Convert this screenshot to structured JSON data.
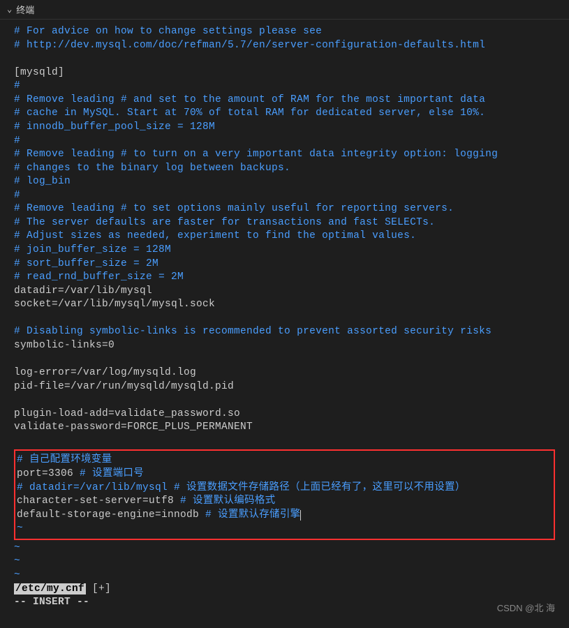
{
  "panel": {
    "title": "终端"
  },
  "terminal": {
    "lines": [
      {
        "type": "comment",
        "text": "# For advice on how to change settings please see"
      },
      {
        "type": "comment",
        "text": "# http://dev.mysql.com/doc/refman/5.7/en/server-configuration-defaults.html"
      },
      {
        "type": "blank",
        "text": ""
      },
      {
        "type": "normal",
        "text": "[mysqld]"
      },
      {
        "type": "comment",
        "text": "#"
      },
      {
        "type": "comment",
        "text": "# Remove leading # and set to the amount of RAM for the most important data"
      },
      {
        "type": "comment",
        "text": "# cache in MySQL. Start at 70% of total RAM for dedicated server, else 10%."
      },
      {
        "type": "comment",
        "text": "# innodb_buffer_pool_size = 128M"
      },
      {
        "type": "comment",
        "text": "#"
      },
      {
        "type": "comment",
        "text": "# Remove leading # to turn on a very important data integrity option: logging"
      },
      {
        "type": "comment",
        "text": "# changes to the binary log between backups."
      },
      {
        "type": "comment",
        "text": "# log_bin"
      },
      {
        "type": "comment",
        "text": "#"
      },
      {
        "type": "comment",
        "text": "# Remove leading # to set options mainly useful for reporting servers."
      },
      {
        "type": "comment",
        "text": "# The server defaults are faster for transactions and fast SELECTs."
      },
      {
        "type": "comment",
        "text": "# Adjust sizes as needed, experiment to find the optimal values."
      },
      {
        "type": "comment",
        "text": "# join_buffer_size = 128M"
      },
      {
        "type": "comment",
        "text": "# sort_buffer_size = 2M"
      },
      {
        "type": "comment",
        "text": "# read_rnd_buffer_size = 2M"
      },
      {
        "type": "normal",
        "text": "datadir=/var/lib/mysql"
      },
      {
        "type": "normal",
        "text": "socket=/var/lib/mysql/mysql.sock"
      },
      {
        "type": "blank",
        "text": ""
      },
      {
        "type": "comment",
        "text": "# Disabling symbolic-links is recommended to prevent assorted security risks"
      },
      {
        "type": "normal",
        "text": "symbolic-links=0"
      },
      {
        "type": "blank",
        "text": ""
      },
      {
        "type": "normal",
        "text": "log-error=/var/log/mysqld.log"
      },
      {
        "type": "normal",
        "text": "pid-file=/var/run/mysqld/mysqld.pid"
      },
      {
        "type": "blank",
        "text": ""
      },
      {
        "type": "normal",
        "text": "plugin-load-add=validate_password.so"
      },
      {
        "type": "normal",
        "text": "validate-password=FORCE_PLUS_PERMANENT"
      },
      {
        "type": "blank",
        "text": ""
      }
    ],
    "boxed_lines": [
      {
        "parts": [
          {
            "cls": "comment",
            "text": "# 自己配置环境变量"
          }
        ]
      },
      {
        "parts": [
          {
            "cls": "normal",
            "text": "port=3306 "
          },
          {
            "cls": "comment",
            "text": "# 设置端口号"
          }
        ]
      },
      {
        "parts": [
          {
            "cls": "comment",
            "text": "# datadir=/var/lib/mysql # 设置数据文件存储路径（上面已经有了，这里可以不用设置）"
          }
        ]
      },
      {
        "parts": [
          {
            "cls": "normal",
            "text": "character-set-server=utf8 "
          },
          {
            "cls": "comment",
            "text": "# 设置默认编码格式"
          }
        ]
      },
      {
        "parts": [
          {
            "cls": "normal",
            "text": "default-storage-engine=innodb "
          },
          {
            "cls": "comment",
            "text": "# 设置默认存储引擎"
          }
        ],
        "cursor": true
      },
      {
        "parts": [
          {
            "cls": "tilde",
            "text": "~"
          }
        ]
      }
    ],
    "trailing_tildes": [
      "~",
      "~",
      "~"
    ],
    "file_path": "/etc/my.cnf",
    "file_suffix": " [+]",
    "mode": "-- INSERT --"
  },
  "watermark": "CSDN @北  海"
}
